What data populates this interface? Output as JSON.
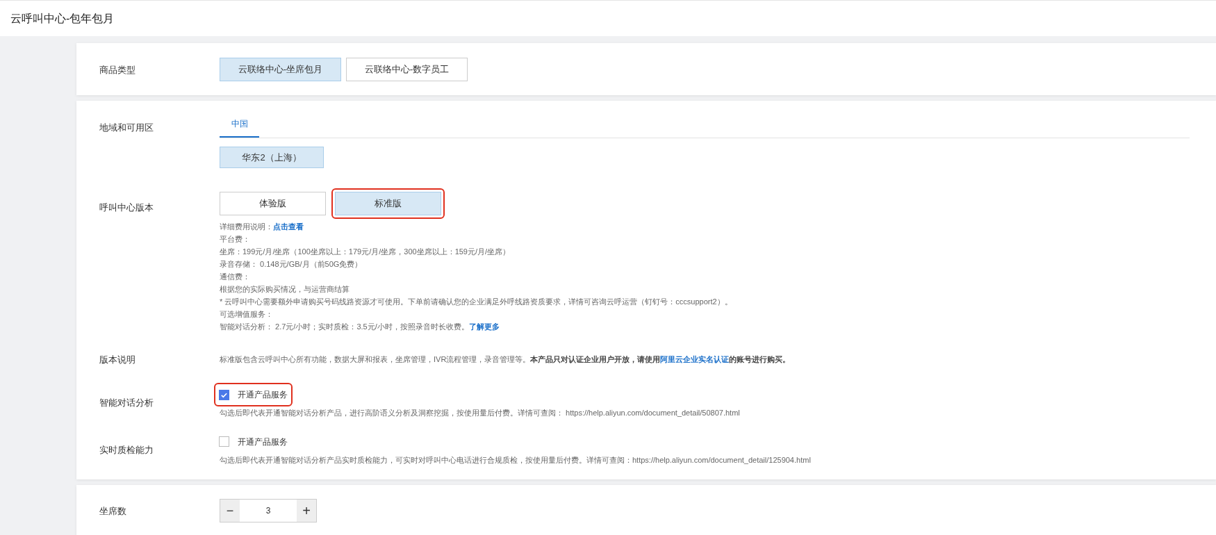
{
  "page_title": "云呼叫中心-包年包月",
  "product_type": {
    "label": "商品类型",
    "options": [
      {
        "label": "云联络中心-坐席包月",
        "selected": true
      },
      {
        "label": "云联络中心-数字员工",
        "selected": false
      }
    ]
  },
  "region": {
    "label": "地域和可用区",
    "tabs": [
      {
        "label": "中国",
        "selected": true
      }
    ],
    "zones": [
      {
        "label": "华东2（上海）",
        "selected": true
      }
    ]
  },
  "edition": {
    "label": "呼叫中心版本",
    "options": [
      {
        "label": "体验版",
        "selected": false,
        "highlighted": false
      },
      {
        "label": "标准版",
        "selected": true,
        "highlighted": true
      }
    ],
    "details": [
      [
        {
          "kind": "text",
          "text": "详细费用说明："
        },
        {
          "kind": "link",
          "text": "点击查看"
        }
      ],
      [
        {
          "kind": "text",
          "text": "平台费："
        }
      ],
      [
        {
          "kind": "text",
          "text": "坐席：199元/月/坐席（100坐席以上：179元/月/坐席，300坐席以上：159元/月/坐席）"
        }
      ],
      [
        {
          "kind": "text",
          "text": "录音存储： 0.148元/GB/月（前50G免费）"
        }
      ],
      [
        {
          "kind": "text",
          "text": "通信费："
        }
      ],
      [
        {
          "kind": "text",
          "text": "根据您的实际购买情况，与运营商结算"
        }
      ],
      [
        {
          "kind": "text",
          "text": "* 云呼叫中心需要额外申请购买号码线路资源才可使用。下单前请确认您的企业满足外呼线路资质要求，详情可咨询云呼运营（钉钉号：cccsupport2）。"
        }
      ],
      [
        {
          "kind": "text",
          "text": "可选增值服务："
        }
      ],
      [
        {
          "kind": "text",
          "text": "智能对话分析： 2.7元/小时；实时质检：3.5元/小时，按照录音时长收费。"
        },
        {
          "kind": "link",
          "text": "了解更多"
        }
      ]
    ]
  },
  "edition_note": {
    "label": "版本说明",
    "segments": [
      {
        "kind": "text",
        "text": "标准版包含云呼叫中心所有功能，数据大屏和报表，坐席管理，IVR流程管理，录音管理等。"
      },
      {
        "kind": "bold",
        "text": "本产品只对认证企业用户开放，请使用"
      },
      {
        "kind": "link",
        "text": "阿里云企业实名认证"
      },
      {
        "kind": "bold",
        "text": "的账号进行购买。"
      }
    ]
  },
  "services": [
    {
      "label": "智能对话分析",
      "option": "开通产品服务",
      "checked": true,
      "highlighted": true,
      "hint": "勾选后即代表开通智能对话分析产品，进行高阶语义分析及洞察挖掘，按使用量后付费。详情可查阅： https://help.aliyun.com/document_detail/50807.html"
    },
    {
      "label": "实时质检能力",
      "option": "开通产品服务",
      "checked": false,
      "highlighted": false,
      "hint": "勾选后即代表开通智能对话分析产品实时质检能力，可实时对呼叫中心电话进行合规质检，按使用量后付费。详情可查阅：https://help.aliyun.com/document_detail/125904.html"
    }
  ],
  "seats": {
    "label": "坐席数",
    "minus": "−",
    "value": "3",
    "plus": "+"
  }
}
